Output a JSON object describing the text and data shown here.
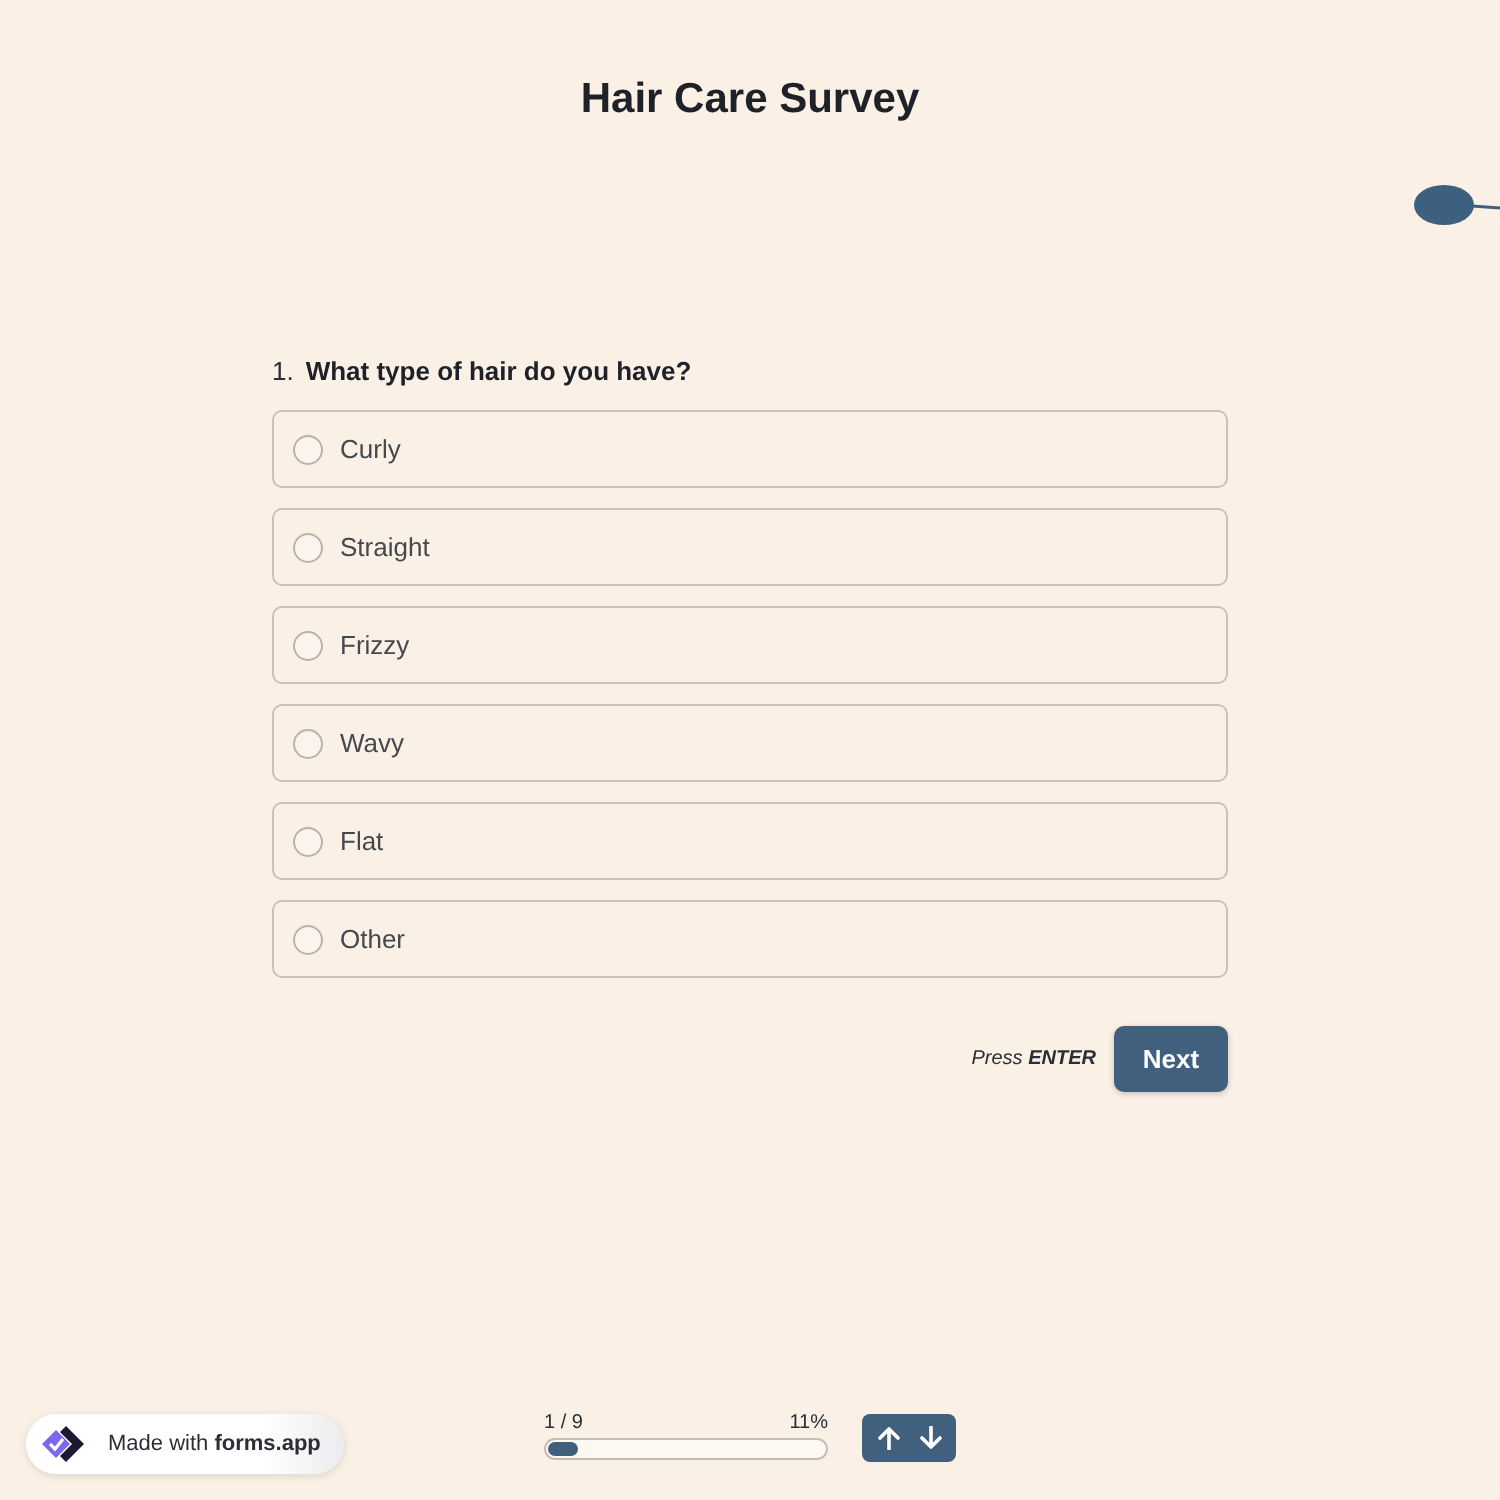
{
  "title": "Hair Care Survey",
  "question": {
    "number": "1.",
    "text": "What type of hair do you have?",
    "options": [
      {
        "label": "Curly",
        "selected": false
      },
      {
        "label": "Straight",
        "selected": false
      },
      {
        "label": "Frizzy",
        "selected": false
      },
      {
        "label": "Wavy",
        "selected": false
      },
      {
        "label": "Flat",
        "selected": false
      },
      {
        "label": "Other",
        "selected": false
      }
    ]
  },
  "submit": {
    "hint": "Press **ENTER**",
    "button": "Next"
  },
  "progress": {
    "count": "1 / 9",
    "percent": "11%",
    "level": 0.11
  },
  "badge": {
    "text": "Made with **forms.app**"
  }
}
